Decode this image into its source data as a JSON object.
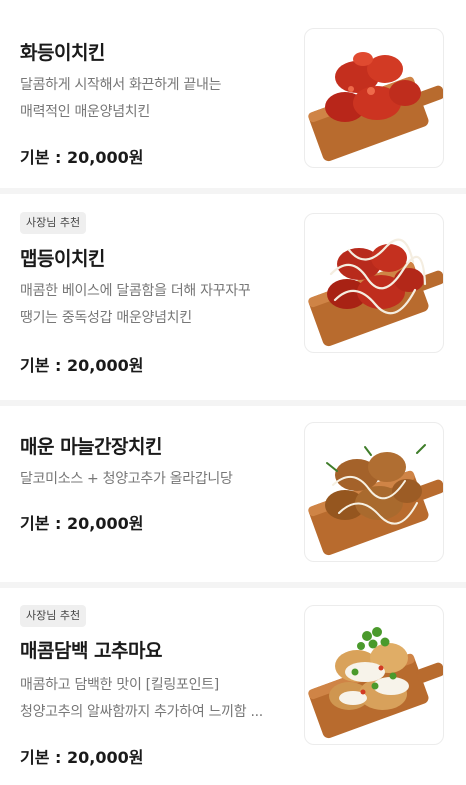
{
  "menu": {
    "items": [
      {
        "name": "화등이치킨",
        "badge": "",
        "desc_line1": "달콤하게 시작해서 화끈하게 끝내는",
        "desc_line2": "매력적인 매운양념치킨",
        "price": "기본 : 20,000원",
        "image": "red-spicy-chicken-on-board"
      },
      {
        "name": "맵등이치킨",
        "badge": "사장님 추천",
        "desc_line1": "매콤한 베이스에 달콤함을 더해 자꾸자꾸",
        "desc_line2": "땡기는 중독성갑 매운양념치킨",
        "price": "기본 : 20,000원",
        "image": "red-chicken-with-mayo-drizzle"
      },
      {
        "name": "매운 마늘간장치킨",
        "badge": "",
        "desc_line1": "달코미소스 + 청양고추가 올라갑니당",
        "desc_line2": "",
        "price": "기본 : 20,000원",
        "image": "garlic-soy-chicken-with-mayo"
      },
      {
        "name": "매콤담백 고추마요",
        "badge": "사장님 추천",
        "desc_line1": "매콤하고 담백한 맛이 [킬링포인트]",
        "desc_line2": "청양고추의 알싸함까지 추가하여 느끼함 ...",
        "price": "기본 : 20,000원",
        "image": "chili-mayo-chicken-with-green-peppers"
      }
    ]
  }
}
